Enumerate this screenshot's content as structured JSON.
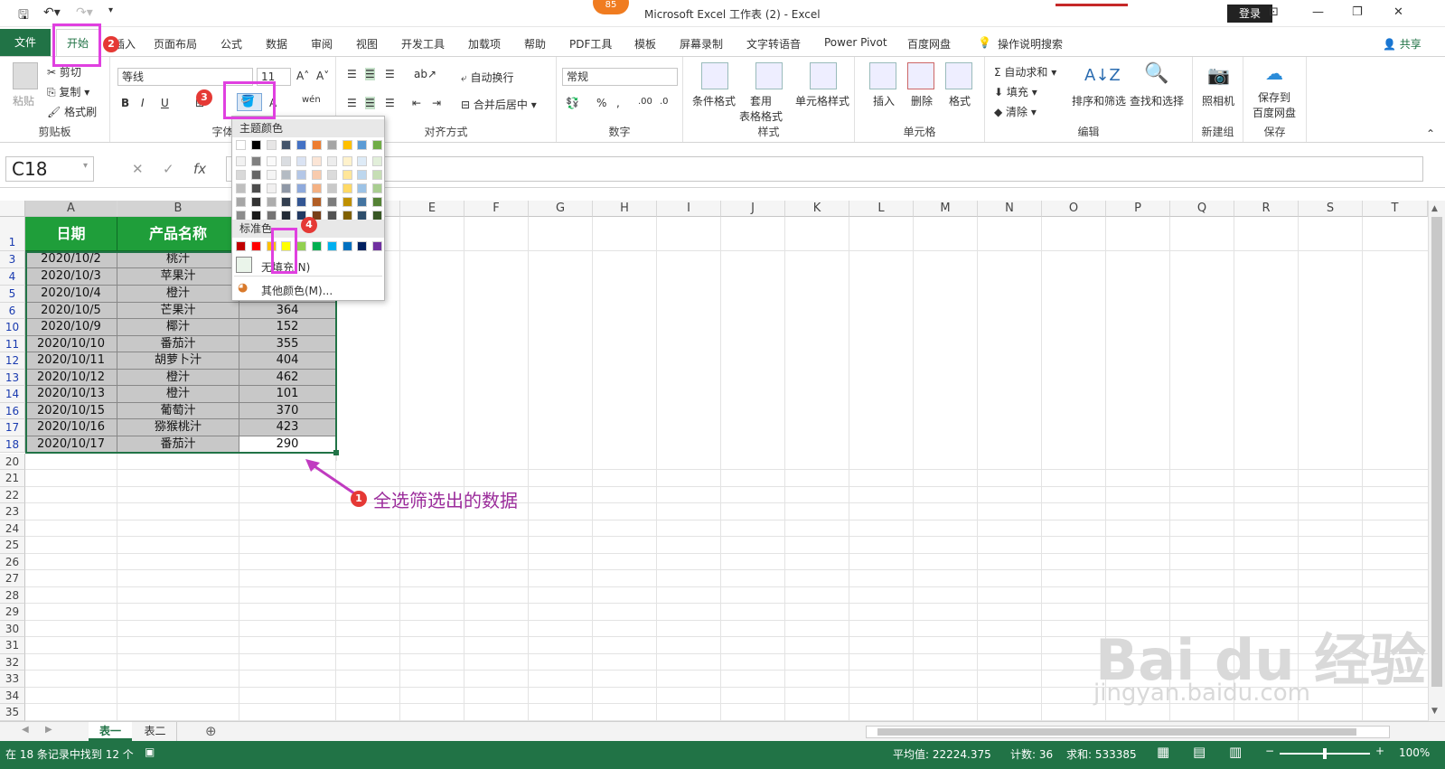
{
  "window": {
    "title": "Microsoft Excel 工作表 (2)  -  Excel",
    "login": "登录",
    "badge_count": "85"
  },
  "tabs": {
    "file": "文件",
    "items": [
      "开始",
      "插入",
      "页面布局",
      "公式",
      "数据",
      "审阅",
      "视图",
      "开发工具",
      "加载项",
      "帮助",
      "PDF工具",
      "模板",
      "屏幕录制",
      "文字转语音",
      "Power Pivot",
      "百度网盘",
      "操作说明搜索"
    ],
    "share": "共享"
  },
  "ribbon": {
    "clipboard": {
      "label": "剪贴板",
      "paste": "粘贴",
      "cut": "剪切",
      "copy": "复制",
      "format_painter": "格式刷"
    },
    "font": {
      "label": "字体",
      "name": "等线",
      "size": "11"
    },
    "alignment": {
      "label": "对齐方式",
      "wrap": "自动换行",
      "merge": "合并后居中"
    },
    "number": {
      "label": "数字",
      "format": "常规"
    },
    "styles": {
      "label": "样式",
      "conditional": "条件格式",
      "table": "套用\n表格格式",
      "cell_styles": "单元格样式"
    },
    "cells": {
      "label": "单元格",
      "insert": "插入",
      "delete": "删除",
      "format": "格式"
    },
    "editing": {
      "label": "编辑",
      "autosum": "自动求和",
      "fill": "填充",
      "clear": "清除",
      "sort_filter": "排序和筛选",
      "find": "查找和选择"
    },
    "newgroup": {
      "label": "新建组",
      "camera": "照相机"
    },
    "save": {
      "label": "保存",
      "save_baidu": "保存到\n百度网盘"
    }
  },
  "formula_bar": {
    "name_box": "C18",
    "fx": "fx"
  },
  "columns": [
    "A",
    "B",
    "C",
    "D",
    "E",
    "F",
    "G",
    "H",
    "I",
    "J",
    "K",
    "L",
    "M",
    "N",
    "O",
    "P",
    "Q",
    "R",
    "S",
    "T"
  ],
  "header_row": {
    "row": "1",
    "date": "日期",
    "product": "产品名称"
  },
  "rows": [
    {
      "row": "3",
      "date": "2020/10/2",
      "product": "桃汁",
      "value": ""
    },
    {
      "row": "4",
      "date": "2020/10/3",
      "product": "苹果汁",
      "value": ""
    },
    {
      "row": "5",
      "date": "2020/10/4",
      "product": "橙汁",
      "value": ""
    },
    {
      "row": "6",
      "date": "2020/10/5",
      "product": "芒果汁",
      "value": "364"
    },
    {
      "row": "10",
      "date": "2020/10/9",
      "product": "椰汁",
      "value": "152"
    },
    {
      "row": "11",
      "date": "2020/10/10",
      "product": "番茄汁",
      "value": "355"
    },
    {
      "row": "12",
      "date": "2020/10/11",
      "product": "胡萝卜汁",
      "value": "404"
    },
    {
      "row": "13",
      "date": "2020/10/12",
      "product": "橙汁",
      "value": "462"
    },
    {
      "row": "14",
      "date": "2020/10/13",
      "product": "橙汁",
      "value": "101"
    },
    {
      "row": "16",
      "date": "2020/10/15",
      "product": "葡萄汁",
      "value": "370"
    },
    {
      "row": "17",
      "date": "2020/10/16",
      "product": "猕猴桃汁",
      "value": "423"
    },
    {
      "row": "18",
      "date": "2020/10/17",
      "product": "番茄汁",
      "value": "290"
    }
  ],
  "empty_rows": [
    "20",
    "21",
    "22",
    "23",
    "24",
    "25",
    "26",
    "27",
    "28",
    "29",
    "30",
    "31",
    "32",
    "33",
    "34",
    "35"
  ],
  "color_dropdown": {
    "theme_label": "主题颜色",
    "standard_label": "标准色",
    "no_fill": "无填充(N)",
    "more_colors": "其他颜色(M)...",
    "theme_top": [
      "#ffffff",
      "#000000",
      "#e7e6e6",
      "#44546a",
      "#4472c4",
      "#ed7d31",
      "#a5a5a5",
      "#ffc000",
      "#5b9bd5",
      "#70ad47"
    ],
    "standard": [
      "#c00000",
      "#ff0000",
      "#ffc000",
      "#ffff00",
      "#92d050",
      "#00b050",
      "#00b0f0",
      "#0070c0",
      "#002060",
      "#7030a0"
    ]
  },
  "annotation": {
    "text": "全选筛选出的数据",
    "step1": "1",
    "step2": "2",
    "step3": "3",
    "step4": "4"
  },
  "sheets": [
    "表一",
    "表二"
  ],
  "status": {
    "left": "在 18 条记录中找到 12 个",
    "average": "平均值: 22224.375",
    "count": "计数: 36",
    "sum": "求和: 533385",
    "zoom": "100%"
  },
  "watermark": {
    "logo": "Bai du 经验",
    "url": "jingyan.baidu.com"
  }
}
